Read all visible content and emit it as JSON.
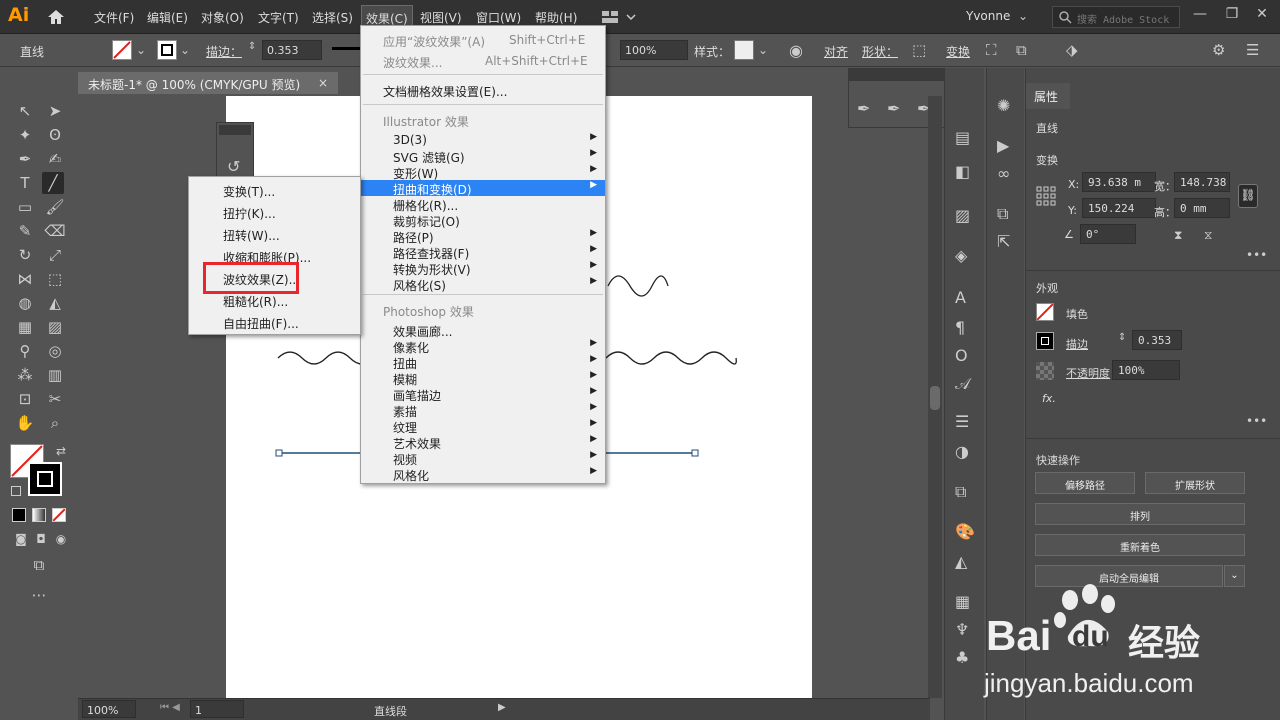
{
  "menubar": {
    "logo": "Ai",
    "items": [
      "文件(F)",
      "编辑(E)",
      "对象(O)",
      "文字(T)",
      "选择(S)",
      "效果(C)",
      "视图(V)",
      "窗口(W)",
      "帮助(H)"
    ],
    "user": "Yvonne",
    "search_placeholder": "搜索 Adobe Stock"
  },
  "control": {
    "label": "直线",
    "stroke_label": "描边：",
    "stroke_value": "0.353",
    "opacity": "100%",
    "style_label": "样式：",
    "align_label": "对齐",
    "shape_label": "形状：",
    "transform_label": "变换"
  },
  "document": {
    "tab_title": "未标题-1* @ 100% (CMYK/GPU 预览)",
    "close": "×"
  },
  "effect_menu": {
    "apply_last": "应用“波纹效果”(A)",
    "apply_last_shortcut": "Shift+Ctrl+E",
    "last_effect": "波纹效果...",
    "last_effect_shortcut": "Alt+Shift+Ctrl+E",
    "raster_settings": "文档栅格效果设置(E)...",
    "illustrator_section": "Illustrator 效果",
    "illustrator_items": [
      "3D(3)",
      "SVG 滤镜(G)",
      "变形(W)",
      "扭曲和变换(D)",
      "栅格化(R)...",
      "裁剪标记(O)",
      "路径(P)",
      "路径查找器(F)",
      "转换为形状(V)",
      "风格化(S)"
    ],
    "photoshop_section": "Photoshop 效果",
    "photoshop_items": [
      "效果画廊...",
      "像素化",
      "扭曲",
      "模糊",
      "画笔描边",
      "素描",
      "纹理",
      "艺术效果",
      "视频",
      "风格化"
    ]
  },
  "distort_menu": {
    "items": [
      "变换(T)...",
      "扭拧(K)...",
      "扭转(W)...",
      "收缩和膨胀(P)...",
      "波纹效果(Z)...",
      "粗糙化(R)...",
      "自由扭曲(F)..."
    ]
  },
  "properties": {
    "tab": "属性",
    "object_type": "直线",
    "transform_title": "变换",
    "x_label": "X:",
    "x_value": "93.638 m",
    "y_label": "Y:",
    "y_value": "150.224",
    "w_label": "宽：",
    "w_value": "148.738",
    "h_label": "高：",
    "h_value": "0 mm",
    "angle_value": "0°",
    "appearance_title": "外观",
    "fill_label": "填色",
    "stroke_label": "描边",
    "stroke_value": "0.353",
    "opacity_label": "不透明度",
    "opacity_value": "100%",
    "fx_label": "fx.",
    "quick_title": "快速操作",
    "btn_offset": "偏移路径",
    "btn_expand": "扩展形状",
    "btn_arrange": "排列",
    "btn_recolor": "重新着色",
    "btn_global_edit": "启动全局编辑"
  },
  "status": {
    "zoom": "100%",
    "page": "1",
    "tool": "直线段"
  },
  "watermark": {
    "brand": "Bai",
    "brand2": "du",
    "cn": "经验",
    "url": "jingyan.baidu.com"
  },
  "colors": {
    "highlight_menu": "#2c84f4",
    "red_box": "#e8262b",
    "app_bg": "#535353",
    "line": "#1f4e79"
  }
}
